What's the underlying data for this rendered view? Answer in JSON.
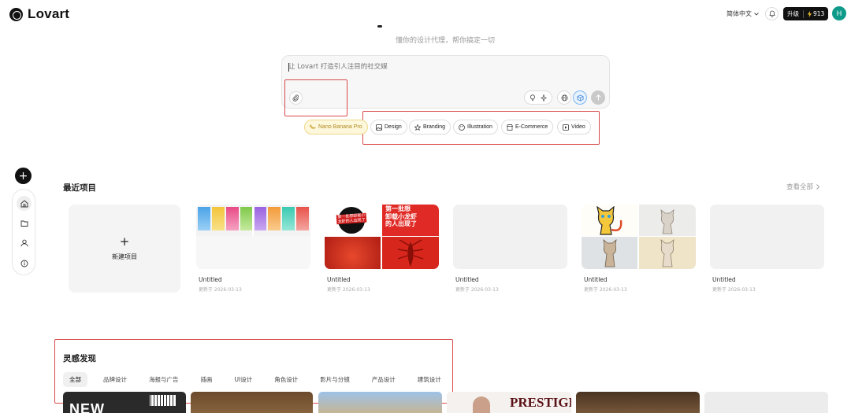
{
  "header": {
    "brand": "Lovart",
    "language": "简体中文",
    "upgrade_label": "升级",
    "credits": "913",
    "avatar_initial": "H"
  },
  "hero": {
    "subtitle": "懂你的设计代理，帮你搞定一切"
  },
  "prompt": {
    "placeholder": "让 Lovart 打造引人注目的社交媒"
  },
  "chips": [
    {
      "label": "Nano Banana Pro",
      "icon": "banana-icon"
    },
    {
      "label": "Design",
      "icon": "image-icon"
    },
    {
      "label": "Branding",
      "icon": "star-icon"
    },
    {
      "label": "Illustration",
      "icon": "palette-icon"
    },
    {
      "label": "E-Commerce",
      "icon": "store-icon"
    },
    {
      "label": "Video",
      "icon": "play-icon"
    }
  ],
  "recent": {
    "title": "最近项目",
    "see_all": "查看全部",
    "new_project": "新建项目",
    "projects": [
      {
        "name": "Untitled",
        "date": "更新于 2026-03-13"
      },
      {
        "name": "Untitled",
        "date": "更新于 2026-03-13"
      },
      {
        "name": "Untitled",
        "date": "更新于 2026-03-13"
      },
      {
        "name": "Untitled",
        "date": "更新于 2026-03-13"
      },
      {
        "name": "Untitled",
        "date": "更新于 2026-03-13"
      }
    ]
  },
  "poster_text": {
    "headline_lines": [
      "第一批想",
      "卸载小龙虾",
      "的人出现了"
    ],
    "badge": "第一批想卸载小龙虾的人出现了"
  },
  "discover": {
    "title": "灵感发现",
    "tabs": [
      "全部",
      "品牌设计",
      "海报与广告",
      "插画",
      "UI设计",
      "角色设计",
      "影片与分镜",
      "产品设计",
      "建筑设计"
    ],
    "gallery_text": [
      "NEW",
      "PRESTIGE"
    ]
  },
  "colors": {
    "accent": "#0e9a8a",
    "highlight": "#d94a4a",
    "nano_chip": "#fdf7dc"
  }
}
